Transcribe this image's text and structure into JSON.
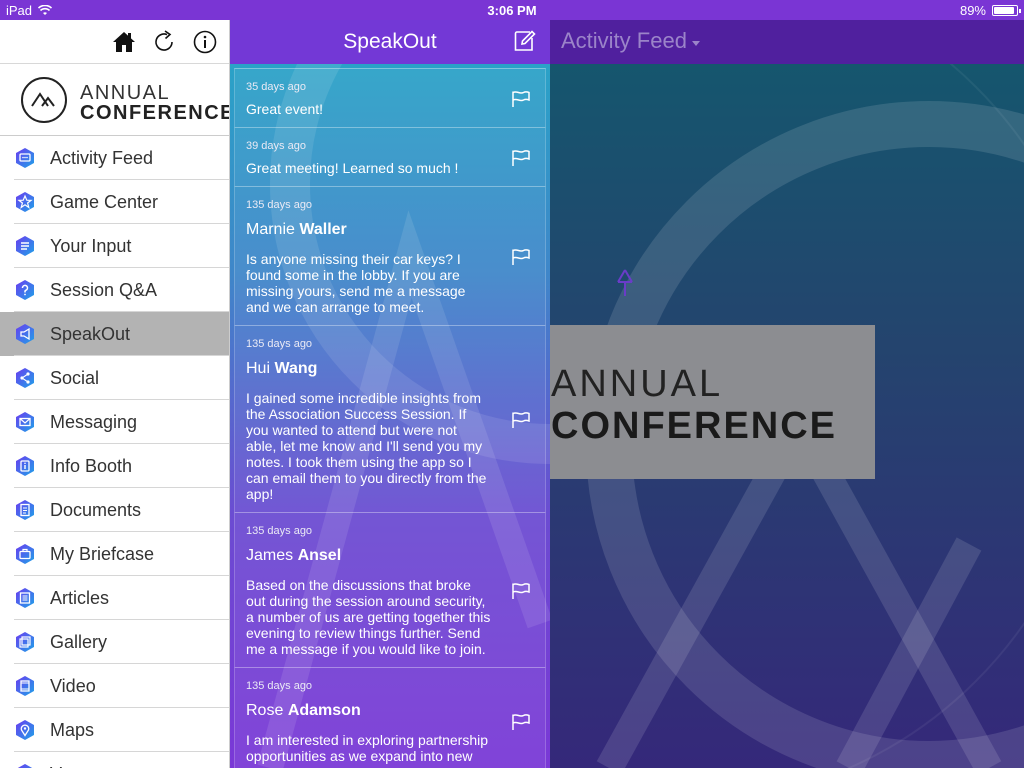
{
  "status_bar": {
    "device": "iPad",
    "time": "3:06 PM",
    "battery": "89%",
    "battery_level": 0.89
  },
  "sidebar": {
    "brand": {
      "line1": "ANNUAL",
      "line2": "CONFERENCE"
    },
    "tools": [
      "home-icon",
      "refresh-icon",
      "info-icon"
    ],
    "items": [
      {
        "label": "Activity Feed",
        "icon": "chat-icon"
      },
      {
        "label": "Game Center",
        "icon": "star-icon"
      },
      {
        "label": "Your Input",
        "icon": "list-icon"
      },
      {
        "label": "Session Q&A",
        "icon": "question-icon"
      },
      {
        "label": "SpeakOut",
        "icon": "megaphone-icon",
        "active": true
      },
      {
        "label": "Social",
        "icon": "share-icon"
      },
      {
        "label": "Messaging",
        "icon": "envelope-icon"
      },
      {
        "label": "Info Booth",
        "icon": "info-booth-icon"
      },
      {
        "label": "Documents",
        "icon": "document-icon"
      },
      {
        "label": "My Briefcase",
        "icon": "briefcase-icon"
      },
      {
        "label": "Articles",
        "icon": "article-icon"
      },
      {
        "label": "Gallery",
        "icon": "gallery-icon"
      },
      {
        "label": "Video",
        "icon": "video-icon"
      },
      {
        "label": "Maps",
        "icon": "map-pin-icon"
      },
      {
        "label": "Venues",
        "icon": "venue-icon"
      }
    ]
  },
  "speakout": {
    "title": "SpeakOut",
    "posts": [
      {
        "age": "35 days ago",
        "first": "",
        "last": "",
        "body": "Great event!"
      },
      {
        "age": "39 days ago",
        "first": "",
        "last": "",
        "body": "Great meeting! Learned so much !"
      },
      {
        "age": "135 days ago",
        "first": "Marnie",
        "last": "Waller",
        "body": "Is anyone missing their car keys? I found some in the lobby. If you are missing yours, send me a message and we can arrange to meet."
      },
      {
        "age": "135 days ago",
        "first": "Hui",
        "last": "Wang",
        "body": "I gained some incredible insights from the Association Success Session. If you wanted to attend but were not able, let me know and I'll send you my notes. I took them using the app so I can email them to you directly from the app!"
      },
      {
        "age": "135 days ago",
        "first": "James",
        "last": "Ansel",
        "body": "Based on the discussions that broke out during the session around security, a number of us are getting together this evening to review things further. Send me a message if you would like to join."
      },
      {
        "age": "135 days ago",
        "first": "Rose",
        "last": "Adamson",
        "body": "I am interested in exploring partnership opportunities as we expand into new"
      }
    ]
  },
  "main": {
    "title": "Activity Feed",
    "logo": {
      "line1": "ANNUAL",
      "line2": "CONFERENCE"
    }
  },
  "colors": {
    "accent": "#7338d6",
    "active_item": "#b3b3b3",
    "icon_gradient_start": "#6a3cf0",
    "icon_gradient_end": "#1fa3e8"
  }
}
